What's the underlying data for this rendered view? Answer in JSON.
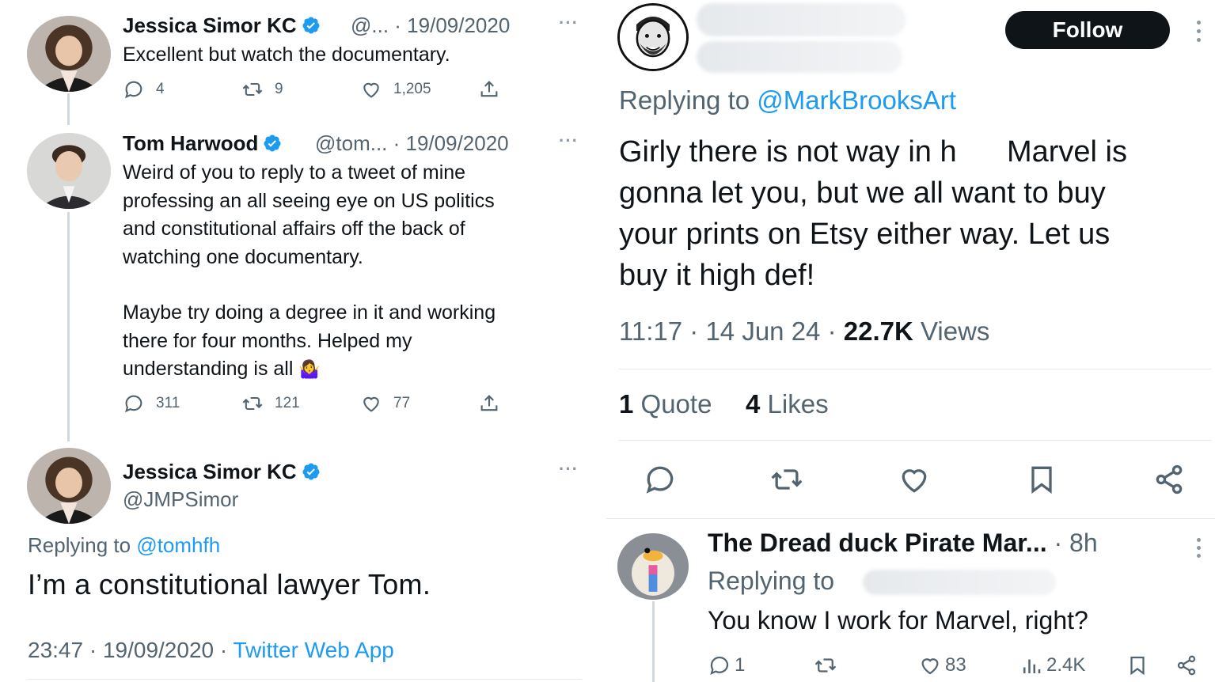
{
  "left": {
    "tweet1": {
      "name": "Jessica Simor KC",
      "meta": "@... · 19/09/2020",
      "more": "···",
      "text": "Excellent but watch the documentary.",
      "replies": "4",
      "retweets": "9",
      "likes": "1,205"
    },
    "tweet2": {
      "name": "Tom Harwood",
      "meta": "@tom... · 19/09/2020",
      "more": "···",
      "text_p1": "Weird of you to reply to a tweet of mine\nprofessing an all seeing eye on US politics\nand constitutional affairs off the back of\nwatching one documentary.",
      "text_p2": "Maybe try doing a degree in it and working\nthere for four months. Helped my\nunderstanding is all",
      "emoji": "🤷‍♀️",
      "replies": "311",
      "retweets": "121",
      "likes": "77"
    },
    "tweet3": {
      "name": "Jessica Simor KC",
      "handle": "@JMPSimor",
      "more": "···",
      "replying_prefix": "Replying to",
      "replying_handle": "@tomhfh",
      "text": "I’m a constitutional lawyer Tom.",
      "time_date": "23:47 · 19/09/2020 ·",
      "source": "Twitter Web App"
    }
  },
  "right": {
    "follow_label": "Follow",
    "replying_prefix": "Replying to",
    "replying_handle": "@MarkBrooksArt",
    "text_lines": [
      "Girly there is not way in h      Marvel is",
      "gonna let you, but we all want to buy",
      "your prints on Etsy either way. Let us",
      "buy it high def!"
    ],
    "time": "11:17 · 14 Jun 24 ·",
    "views_count": "22.7K",
    "views_label": "Views",
    "quotes_count": "1",
    "quotes_label": "Quote",
    "likes_count": "4",
    "likes_label": "Likes",
    "reply": {
      "name": "The Dread duck Pirate Mar...",
      "time": "· 8h",
      "replying_prefix": "Replying to",
      "text": "You know I work for Marvel, right?",
      "replies": "1",
      "likes": "83",
      "views": "2.4K"
    }
  },
  "colors": {
    "accent": "#1d9bf0",
    "muted": "#536471",
    "text": "#0f1419"
  }
}
